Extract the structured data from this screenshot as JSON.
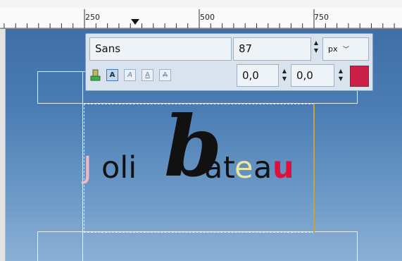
{
  "ruler": {
    "labels": [
      "250",
      "500",
      "750"
    ]
  },
  "text_toolbar": {
    "font_name": "Sans",
    "font_size": "87",
    "unit": "px",
    "unit_chevron": "﹀",
    "spin_up": "▲",
    "spin_down": "▼",
    "baseline_offset": "0,0",
    "kerning": "0,0",
    "color": "#cc1f48",
    "style_buttons": [
      "A",
      "A",
      "A",
      "A"
    ]
  },
  "canvas": {
    "text_segments": [
      {
        "text": "J",
        "color": "#f1b8c0"
      },
      {
        "text": "oli ",
        "color": "#111111"
      },
      {
        "text": "b",
        "color": "#111111"
      },
      {
        "text": "a",
        "color": "#111111"
      },
      {
        "text": "t",
        "color": "#111111"
      },
      {
        "text": "e",
        "color": "#e8e8a0"
      },
      {
        "text": "a",
        "color": "#111111"
      },
      {
        "text": "u",
        "color": "#e0103a"
      }
    ]
  }
}
